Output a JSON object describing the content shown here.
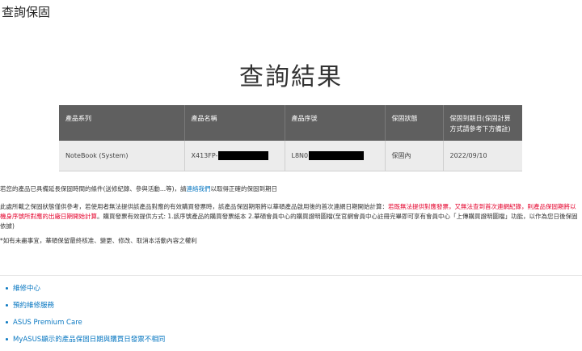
{
  "page": {
    "title": "查詢保固"
  },
  "result": {
    "title": "查詢結果"
  },
  "table": {
    "headers": [
      "產品系列",
      "產品名稱",
      "產品序號",
      "保固狀態",
      "保固到期日(保固計算方式請參考下方備註)"
    ],
    "row": {
      "series": "NoteBook (System)",
      "name_prefix": "X413FP-",
      "serial_prefix": "L8N0",
      "status": "保固內",
      "expiry": "2022/09/10"
    }
  },
  "notes": {
    "line1_a": "若您的產品已具備延長保固時間的條件(送修紀錄、參與活動...等)，請",
    "line1_link": "連絡我們",
    "line1_b": "以取得正確的保固到期日",
    "para2_a": "此處所載之保固狀態僅供參考，若使用者無法提供該產品對應的有效購買發票時，該產品保固期限將以華碩產品啟用後的首次連網日期開始計算：",
    "para2_red": "若既無法提供對應發票，又無法查到首次連網紀錄，則產品保固期將以機身序號所對應的出廠日期開始計算",
    "para2_b": "。購買發票有效提供方式: 1.該序號產品的購買發票紙本 2.華碩會員中心的購買證明圖檔(至官網會員中心註冊完畢即可享有會員中心「上傳購買證明圖檔」功能，以作為您日後保固依據)",
    "line3": "*如有未盡事宜，華碩保留最終核准、變更、修改、取消本活動內容之權利"
  },
  "links": [
    {
      "label": "維修中心"
    },
    {
      "label": "預約維修服務"
    },
    {
      "label": "ASUS Premium Care"
    },
    {
      "label": "MyASUS顯示的產品保固日期與購買日發票不相同"
    }
  ],
  "colors": {
    "link": "#0a78c2",
    "warning": "#e4002b",
    "header_bg": "#5f5f5f",
    "row_bg": "#ececec"
  }
}
